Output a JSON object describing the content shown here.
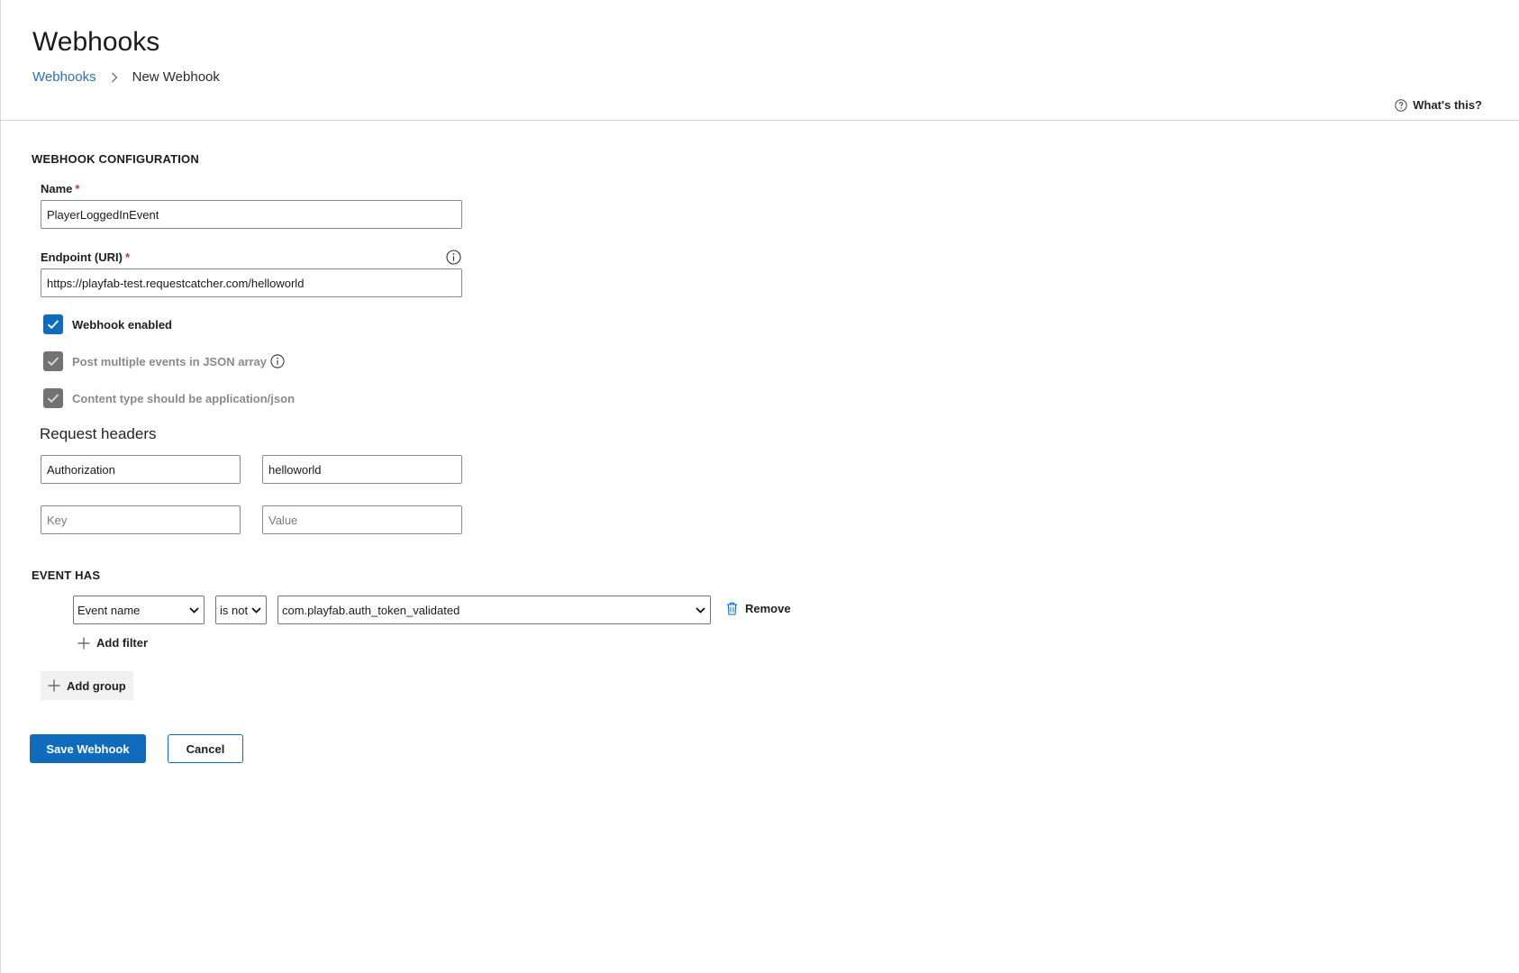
{
  "header": {
    "title": "Webhooks",
    "breadcrumb": [
      {
        "label": "Webhooks"
      },
      {
        "label": "New Webhook"
      }
    ],
    "help_label": "What's this?"
  },
  "config": {
    "section_title": "WEBHOOK CONFIGURATION",
    "name_label": "Name",
    "name_value": "PlayerLoggedInEvent",
    "endpoint_label": "Endpoint (URI)",
    "endpoint_value": "https://playfab-test.requestcatcher.com/helloworld",
    "required_mark": "*",
    "checkboxes": [
      {
        "label": "Webhook enabled",
        "checked": true,
        "disabled": false
      },
      {
        "label": "Post multiple events in JSON array",
        "checked": true,
        "disabled": true
      },
      {
        "label": "Content type should be application/json",
        "checked": true,
        "disabled": true
      }
    ]
  },
  "request_headers": {
    "title": "Request headers",
    "rows": [
      {
        "key": "Authorization",
        "value": "helloworld"
      }
    ],
    "key_placeholder": "Key",
    "value_placeholder": "Value"
  },
  "event_has": {
    "section_title": "EVENT HAS",
    "filter": {
      "field": "Event name",
      "operator": "is not",
      "value": "com.playfab.auth_token_validated"
    },
    "remove_label": "Remove",
    "add_filter_label": "Add filter",
    "add_group_label": "Add group"
  },
  "actions": {
    "save_label": "Save Webhook",
    "cancel_label": "Cancel"
  },
  "colors": {
    "primary": "#0f6cbd",
    "link": "#2f6eb5",
    "required": "#c4314b",
    "disabled_check": "#737373"
  }
}
